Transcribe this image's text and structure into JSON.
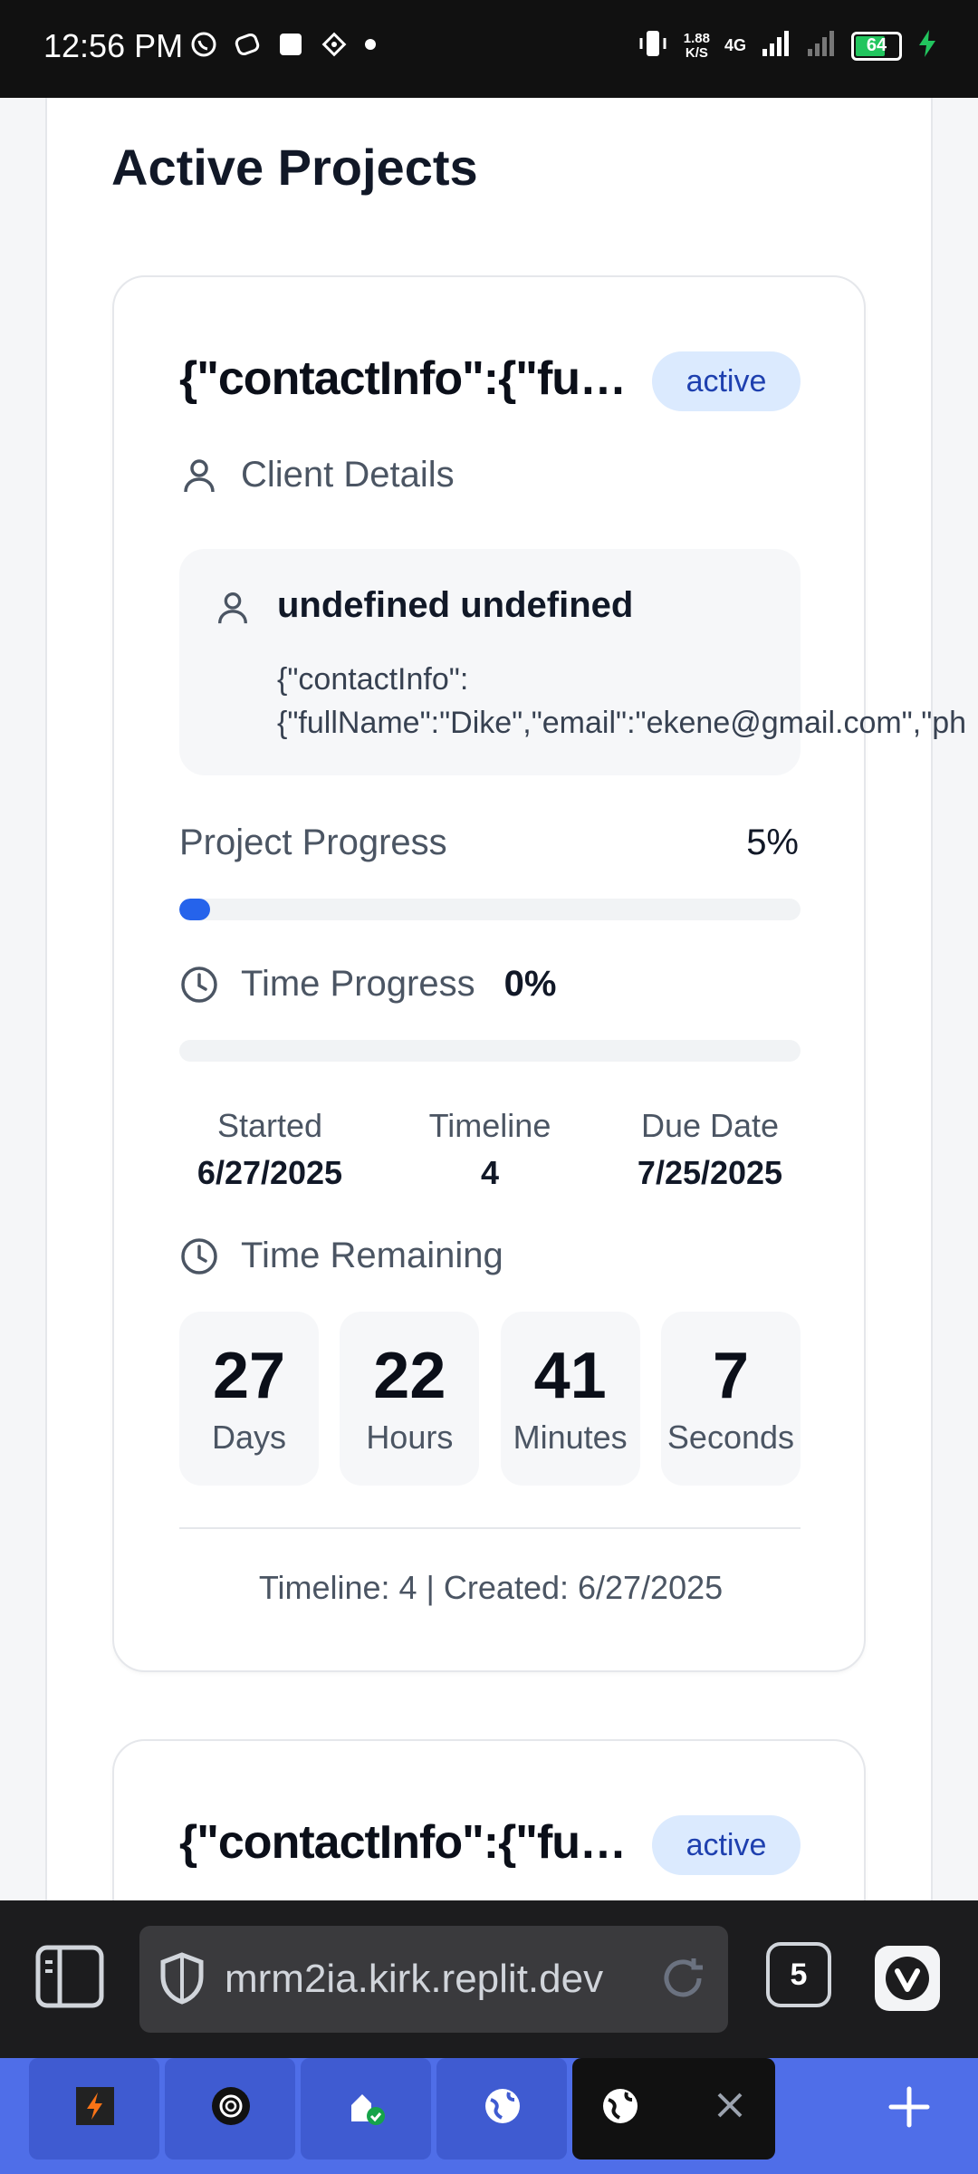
{
  "status_bar": {
    "time": "12:56 PM",
    "network_speed": "1.88",
    "network_speed_unit": "K/S",
    "network_type": "4G",
    "battery_level": "64",
    "icons": [
      "whatsapp-icon",
      "app-icon",
      "square-icon",
      "diamond-icon",
      "dot-icon",
      "vibrate-icon",
      "signal-icon",
      "charging-icon"
    ]
  },
  "page": {
    "title": "Active Projects"
  },
  "project_card": {
    "title": "{\"contactInfo\":{\"fullN...",
    "status": "active",
    "client_section_label": "Client Details",
    "client_name": "undefined undefined",
    "client_info_line1": "{\"contactInfo\":",
    "client_info_line2": "{\"fullName\":\"Dike\",\"email\":\"ekene@gmail.com\",\"ph",
    "project_progress_label": "Project Progress",
    "project_progress_value": "5%",
    "project_progress": 5,
    "time_progress_label": "Time Progress",
    "time_progress_value": "0%",
    "time_progress": 0,
    "started_label": "Started",
    "started_value": "6/27/2025",
    "timeline_label": "Timeline",
    "timeline_value": "4",
    "due_label": "Due Date",
    "due_value": "7/25/2025",
    "time_remaining_label": "Time Remaining",
    "countdown": [
      {
        "value": "27",
        "unit": "Days"
      },
      {
        "value": "22",
        "unit": "Hours"
      },
      {
        "value": "41",
        "unit": "Minutes"
      },
      {
        "value": "7",
        "unit": "Seconds"
      }
    ],
    "footer": "Timeline: 4 | Created: 6/27/2025"
  },
  "project_card_2": {
    "title": "{\"contactInfo\":{\"fullN...",
    "status": "active"
  },
  "browser": {
    "url": "mrm2ia.kirk.replit.dev",
    "tab_count": "5"
  },
  "colors": {
    "accent": "#2563eb",
    "badge_bg": "#dbeafe",
    "badge_text": "#1e40af",
    "tabstrip": "#4f6ee8"
  }
}
